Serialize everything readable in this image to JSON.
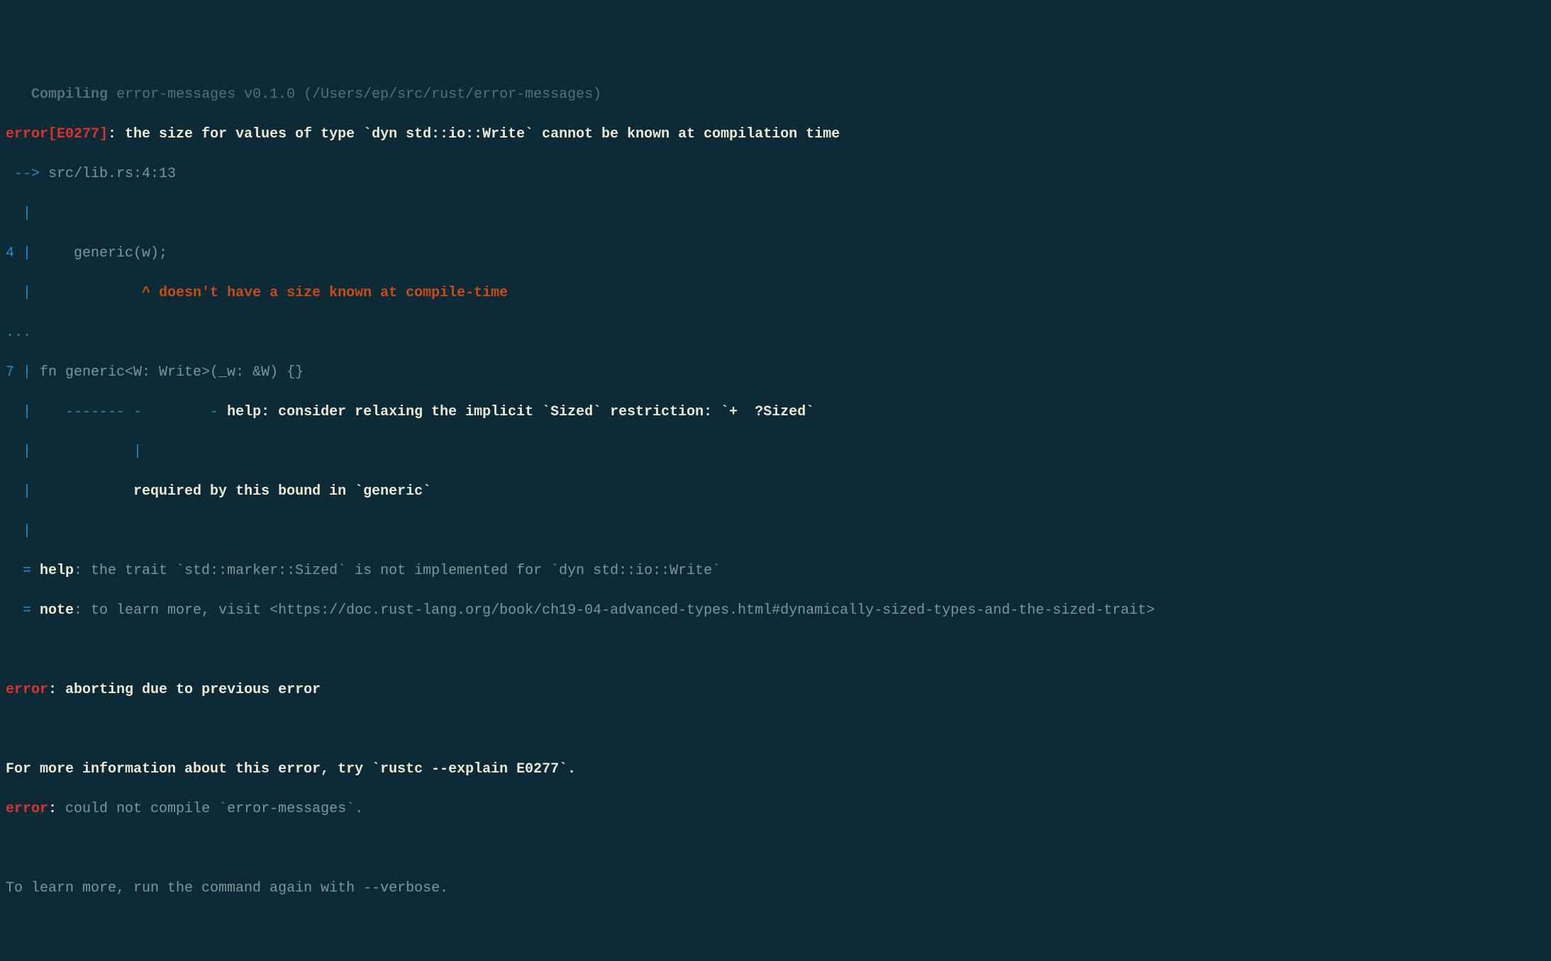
{
  "compiling": {
    "label": "Compiling",
    "package": "error-messages v0.1.0 (/Users/ep/src/rust/error-messages)"
  },
  "error_header": {
    "error_label": "error",
    "error_code": "[E0277]",
    "colon": ": ",
    "message": "the size for values of type `dyn std::io::Write` cannot be known at compilation time"
  },
  "location": {
    "arrow": " -->",
    "path": " src/lib.rs:4:13"
  },
  "gutter": {
    "pipe_only": "  |",
    "line4": "4 |",
    "dots": "...",
    "line7": "7 |",
    "equals": "  ="
  },
  "src": {
    "line4_code": "     generic(w);",
    "line4_caret": "             ^ ",
    "line4_msg": "doesn't have a size known at compile-time",
    "line7_code": " fn generic<W: Write>(_w: &W) {}",
    "line7_under": "    ------- -        - ",
    "line7_help_label": "help: ",
    "line7_help_msg": "consider relaxing the implicit `Sized` restriction: `+  ?Sized`",
    "line7_pipe": "            |",
    "line7_required": "            required by this bound in `generic`"
  },
  "notes": {
    "help_label": " help",
    "help_text": ": the trait `std::marker::Sized` is not implemented for `dyn std::io::Write`",
    "note_label": " note",
    "note_text": ": to learn more, visit <https://doc.rust-lang.org/book/ch19-04-advanced-types.html#dynamically-sized-types-and-the-sized-trait>"
  },
  "aborting": {
    "error_label": "error",
    "colon": ": ",
    "msg": "aborting due to previous error"
  },
  "more_info": "For more information about this error, try `rustc --explain E0277`.",
  "compile_err": {
    "error_label": "error",
    "colon": ": ",
    "msg": "could not compile `error-messages`."
  },
  "verbose": "To learn more, run the command again with --verbose."
}
